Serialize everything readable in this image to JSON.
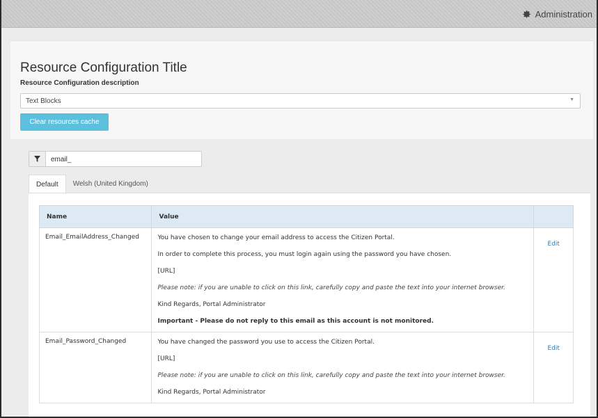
{
  "header": {
    "admin_label": "Administration"
  },
  "config": {
    "title": "Resource Configuration Title",
    "description": "Resource Configuration description",
    "select_value": "Text Blocks",
    "clear_button": "Clear resources cache"
  },
  "filter": {
    "value": "email_"
  },
  "tabs": [
    {
      "label": "Default",
      "active": true
    },
    {
      "label": "Welsh (United Kingdom)",
      "active": false
    }
  ],
  "table": {
    "columns": [
      "Name",
      "Value",
      ""
    ],
    "rows": [
      {
        "name": "Email_EmailAddress_Changed",
        "lines": [
          {
            "text": "You have chosen to change your email address to access the Citizen Portal.",
            "style": "normal"
          },
          {
            "text": "In order to complete this process, you must login again using the password you have chosen.",
            "style": "normal"
          },
          {
            "text": "[URL]",
            "style": "normal"
          },
          {
            "text": "Please note: if you are unable to click on this link, carefully copy and paste the text into your internet browser.",
            "style": "italic"
          },
          {
            "text": "Kind Regards, Portal Administrator",
            "style": "normal"
          },
          {
            "text": "Important - Please do not reply to this email as this account is not monitored.",
            "style": "bold"
          }
        ],
        "action": "Edit"
      },
      {
        "name": "Email_Password_Changed",
        "lines": [
          {
            "text": "You have changed the password you use to access the Citizen Portal.",
            "style": "normal"
          },
          {
            "text": "[URL]",
            "style": "normal"
          },
          {
            "text": "Please note: if you are unable to click on this link, carefully copy and paste the text into your internet browser.",
            "style": "italic"
          },
          {
            "text": "Kind Regards, Portal Administrator",
            "style": "normal"
          }
        ],
        "action": "Edit"
      }
    ]
  },
  "colors": {
    "accent_button": "#5bc0de",
    "table_header": "#dde9f4",
    "link": "#2a7ab8"
  },
  "icons": {
    "admin": "gear-icon",
    "filter": "filter-icon",
    "select": "caret-down-icon"
  }
}
